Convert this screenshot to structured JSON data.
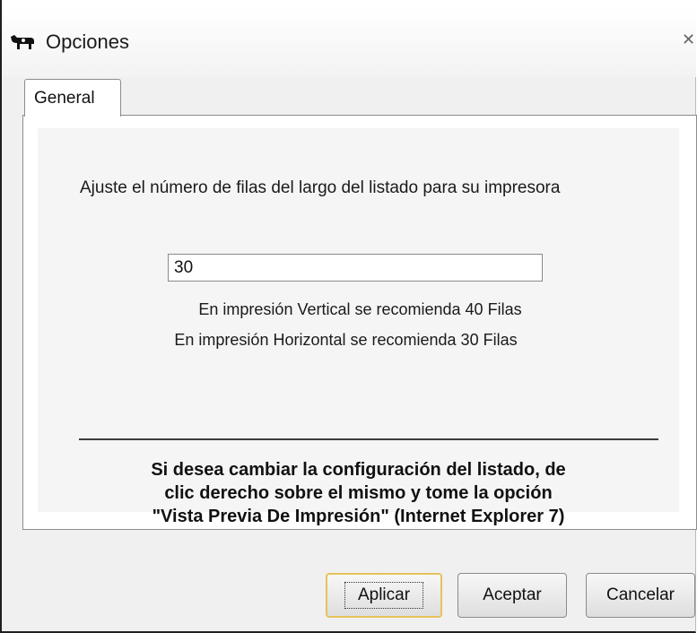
{
  "window": {
    "title": "Opciones",
    "close_glyph": "✕",
    "icon": "cow-icon"
  },
  "tabs": [
    {
      "label": "General",
      "selected": true
    }
  ],
  "general": {
    "instruction": "Ajuste el número de filas del largo del listado para su impresora",
    "rows_value": "30",
    "hint_vertical": "En impresión Vertical se recomienda 40 Filas",
    "hint_horizontal": "En impresión Horizontal se recomienda 30 Filas",
    "note_line1": "Si desea cambiar la configuración del listado,  de",
    "note_line2": "clic derecho sobre el mismo y tome la opción",
    "note_line3": "\"Vista Previa De Impresión\" (Internet Explorer 7)"
  },
  "buttons": {
    "apply": "Aplicar",
    "ok": "Aceptar",
    "cancel": "Cancelar"
  },
  "colors": {
    "focus_border": "#e8c25a",
    "panel_background": "#f5f5f5"
  }
}
